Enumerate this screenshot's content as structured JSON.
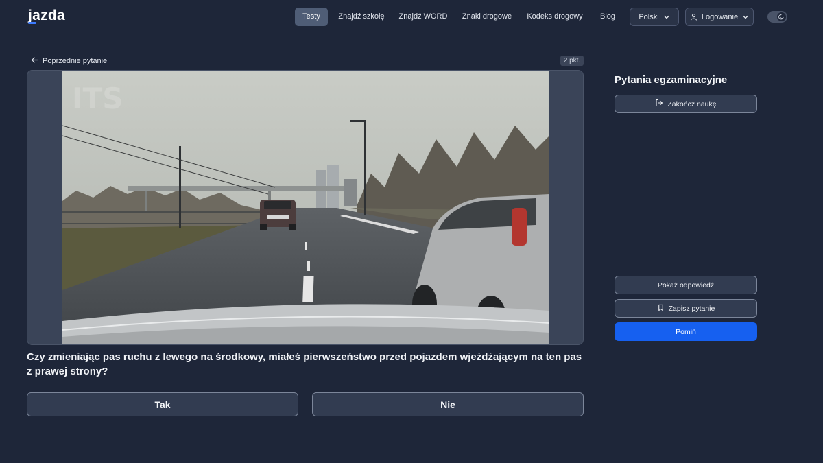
{
  "header": {
    "logo_text": "jazda",
    "nav": [
      {
        "label": "Testy",
        "active": true
      },
      {
        "label": "Znajdź szkołę",
        "active": false
      },
      {
        "label": "Znajdź WORD",
        "active": false
      },
      {
        "label": "Znaki drogowe",
        "active": false
      },
      {
        "label": "Kodeks drogowy",
        "active": false
      },
      {
        "label": "Blog",
        "active": false
      }
    ],
    "language": "Polski",
    "login": "Logowanie"
  },
  "main": {
    "back_label": "Poprzednie pytanie",
    "points": "2 pkt.",
    "question": "Czy zmieniając pas ruchu z lewego na środkowy, miałeś pierwszeństwo przed pojazdem wjeżdżającym na ten pas z prawej strony?",
    "answers": {
      "yes": "Tak",
      "no": "Nie"
    }
  },
  "sidebar": {
    "title": "Pytania egzaminacyjne",
    "finish": "Zakończ naukę",
    "show_answer": "Pokaż odpowiedź",
    "save_question": "Zapisz pytanie",
    "skip": "Pomiń"
  },
  "colors": {
    "background": "#1e2639",
    "accent": "#1660f0",
    "active_nav": "#4f5d76"
  }
}
